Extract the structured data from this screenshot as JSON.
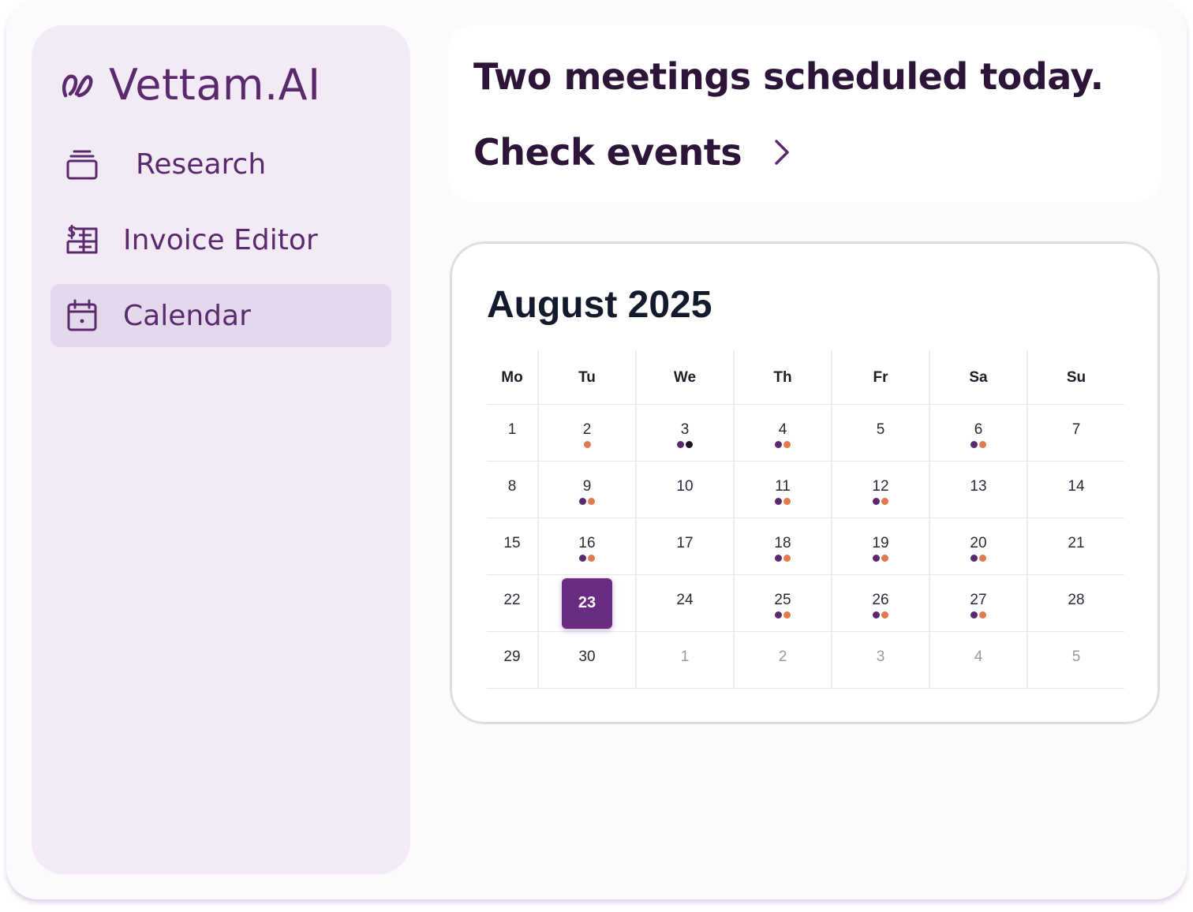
{
  "brand": {
    "name": "Vettam.AI"
  },
  "sidebar": {
    "items": [
      {
        "label": "Research",
        "icon": "stack-icon",
        "active": false
      },
      {
        "label": "Invoice Editor",
        "icon": "invoice-icon",
        "active": false
      },
      {
        "label": "Calendar",
        "icon": "calendar-icon",
        "active": true
      }
    ]
  },
  "notice": {
    "title": "Two meetings scheduled today.",
    "action_label": "Check events"
  },
  "calendar": {
    "month_label": "August 2025",
    "weekdays": [
      "Mo",
      "Tu",
      "We",
      "Th",
      "Fr",
      "Sa",
      "Su"
    ],
    "weeks": [
      [
        {
          "d": "1"
        },
        {
          "d": "2",
          "dots": [
            "orange"
          ]
        },
        {
          "d": "3",
          "dots": [
            "purple",
            "dark"
          ]
        },
        {
          "d": "4",
          "dots": [
            "purple",
            "orange"
          ]
        },
        {
          "d": "5"
        },
        {
          "d": "6",
          "dots": [
            "purple",
            "orange"
          ]
        },
        {
          "d": "7"
        }
      ],
      [
        {
          "d": "8"
        },
        {
          "d": "9",
          "dots": [
            "purple",
            "orange"
          ]
        },
        {
          "d": "10"
        },
        {
          "d": "11",
          "dots": [
            "purple",
            "orange"
          ]
        },
        {
          "d": "12",
          "dots": [
            "purple",
            "orange"
          ]
        },
        {
          "d": "13"
        },
        {
          "d": "14"
        }
      ],
      [
        {
          "d": "15"
        },
        {
          "d": "16",
          "dots": [
            "purple",
            "orange"
          ]
        },
        {
          "d": "17"
        },
        {
          "d": "18",
          "dots": [
            "purple",
            "orange"
          ]
        },
        {
          "d": "19",
          "dots": [
            "purple",
            "orange"
          ]
        },
        {
          "d": "20",
          "dots": [
            "purple",
            "orange"
          ]
        },
        {
          "d": "21"
        }
      ],
      [
        {
          "d": "22"
        },
        {
          "d": "23",
          "today": true
        },
        {
          "d": "24"
        },
        {
          "d": "25",
          "dots": [
            "purple",
            "orange"
          ]
        },
        {
          "d": "26",
          "dots": [
            "purple",
            "orange"
          ]
        },
        {
          "d": "27",
          "dots": [
            "purple",
            "orange"
          ]
        },
        {
          "d": "28"
        }
      ],
      [
        {
          "d": "29"
        },
        {
          "d": "30"
        },
        {
          "d": "1",
          "muted": true
        },
        {
          "d": "2",
          "muted": true
        },
        {
          "d": "3",
          "muted": true
        },
        {
          "d": "4",
          "muted": true
        },
        {
          "d": "5",
          "muted": true
        }
      ]
    ]
  },
  "colors": {
    "accent": "#6a2c80",
    "brand_text": "#5b2a6e",
    "event_purple": "#5b2a6e",
    "event_orange": "#e07a4e",
    "sidebar_bg": "#f2ebf6",
    "active_item_bg": "#e4d9ec"
  }
}
